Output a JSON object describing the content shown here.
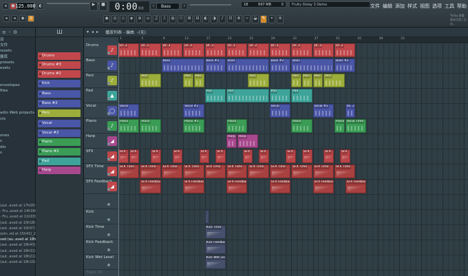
{
  "topbar": {
    "tempo": "125.000",
    "timer_main": "0:00",
    "timer_sub": "00",
    "preset_field": "Bass",
    "cpu_left": "18",
    "cpu_mid": "697 MB",
    "cpu_right": "0",
    "song_title": "Fruity Delay 3 Demo",
    "menu": [
      "文件",
      "编辑",
      "添加",
      "样式",
      "视图",
      "选项",
      "工具",
      "帮助"
    ],
    "news_line1": "Today  查看",
    "news_line2": "版本可用 | 点击..."
  },
  "browser": {
    "head_icon": "≡",
    "items": [
      {
        "label": "目",
        "hl": false
      },
      {
        "label": "文件",
        "hl": false
      },
      {
        "label": "resets",
        "hl": false
      },
      {
        "label": "展库",
        "hl": false
      },
      {
        "label": "presets",
        "hl": false
      },
      {
        "label": "esets",
        "hl": false
      },
      {
        "label": "",
        "hl": false
      },
      {
        "label": "",
        "hl": false
      },
      {
        "label": "envelopes",
        "hl": false
      },
      {
        "label": "files",
        "hl": false
      },
      {
        "label": "",
        "hl": false
      },
      {
        "label": "",
        "hl": false
      },
      {
        "label": "",
        "hl": false
      },
      {
        "label": "adio Web projects",
        "hl": false
      },
      {
        "label": "cts",
        "hl": false
      },
      {
        "label": "",
        "hl": false
      },
      {
        "label": "",
        "hl": false
      },
      {
        "label": "ones",
        "hl": false
      },
      {
        "label": "s",
        "hl": false
      },
      {
        "label": "dio",
        "hl": false
      },
      {
        "label": "s",
        "hl": false
      },
      {
        "label": "",
        "hl": false
      }
    ],
    "recent": [
      "(aut..aved at 17h05)",
      "- Fru..aved at 14h34)",
      "- Fru..aved at 11h03)",
      "(aut..aved at 10h18)",
      "(aut..aved at 10h57)",
      "ostn..ed at 15h43)_2",
      "ved (au..aved at 18h54)",
      "(aut..aved at 18h43)",
      "(aut..aved at 18h31)",
      "(aut..aved at 18h21)",
      "(aut..aved at 18h10)"
    ]
  },
  "patterns": {
    "head": "Ш",
    "items": [
      {
        "label": "Drums",
        "color": "#c0474b"
      },
      {
        "label": "Drums #3",
        "color": "#c0474b"
      },
      {
        "label": "Drums #2",
        "color": "#c0474b"
      },
      {
        "label": "Kick",
        "color": "#4a56a6"
      },
      {
        "label": "Bass",
        "color": "#4a56a6"
      },
      {
        "label": "Bass #2",
        "color": "#4a56a6"
      },
      {
        "label": "Perc",
        "color": "#9cad3b"
      },
      {
        "label": "Vocal",
        "color": "#4a56a6"
      },
      {
        "label": "Vocal #2",
        "color": "#4a56a6"
      },
      {
        "label": "Piano",
        "color": "#3a9c55"
      },
      {
        "label": "Piano #2",
        "color": "#3a9c55"
      },
      {
        "label": "Pad",
        "color": "#3ea49a"
      },
      {
        "label": "Harp",
        "color": "#a8498e"
      }
    ]
  },
  "playlist": {
    "title": "播放列表 - 编曲",
    "sub": "›(无)",
    "ruler": [
      "1",
      "5",
      "9",
      "13",
      "17",
      "21",
      "25",
      "29",
      "33",
      "37",
      "41",
      "45",
      "49",
      "53"
    ],
    "tracks": [
      {
        "name": "Drums",
        "icon": "♪",
        "color": "#c0474b"
      },
      {
        "name": "Bass",
        "icon": "♪",
        "color": "#4a56a6"
      },
      {
        "name": "Perc",
        "icon": "♪",
        "color": "#9cad3b"
      },
      {
        "name": "Pad",
        "icon": "▲",
        "color": "#3ea49a"
      },
      {
        "name": "Vocal",
        "icon": "◯",
        "color": "#4a56a6"
      },
      {
        "name": "Piano",
        "icon": "♪",
        "color": "#3a9c55"
      },
      {
        "name": "Harp",
        "icon": "◢",
        "color": "#a8498e"
      },
      {
        "name": "SFX",
        "icon": "◢",
        "color": "#c0474b"
      },
      {
        "name": "SFX Time",
        "icon": "◢",
        "color": "#c0474b"
      },
      {
        "name": "SFX Feedback",
        "icon": "◢",
        "color": "#c0474b"
      },
      {
        "name": "",
        "icon": "",
        "color": ""
      },
      {
        "name": "Kick",
        "icon": "",
        "color": ""
      },
      {
        "name": "Kick Time",
        "icon": "",
        "color": ""
      },
      {
        "name": "Kick Feedback",
        "icon": "",
        "color": ""
      },
      {
        "name": "Kick Wet Level",
        "icon": "",
        "color": ""
      },
      {
        "name": "Track 15",
        "icon": "",
        "color": ""
      }
    ],
    "clips": [
      {
        "t": 0,
        "s": 0,
        "w": 4,
        "label": "Dr..3",
        "color": "#c0474b"
      },
      {
        "t": 0,
        "s": 4,
        "w": 4,
        "label": "Dr..3",
        "color": "#c0474b"
      },
      {
        "t": 0,
        "s": 8,
        "w": 4,
        "label": "Dr..3",
        "color": "#c0474b"
      },
      {
        "t": 0,
        "s": 12,
        "w": 4,
        "label": "Dr..3",
        "color": "#c0474b"
      },
      {
        "t": 0,
        "s": 16,
        "w": 4,
        "label": "Dr..3",
        "color": "#c0474b"
      },
      {
        "t": 0,
        "s": 20,
        "w": 4,
        "label": "Dr..3",
        "color": "#c0474b"
      },
      {
        "t": 0,
        "s": 24,
        "w": 4,
        "label": "Dr..3",
        "color": "#c0474b"
      },
      {
        "t": 0,
        "s": 28,
        "w": 4,
        "label": "Dr..3",
        "color": "#c0474b"
      },
      {
        "t": 0,
        "s": 32,
        "w": 4,
        "label": "Dr..3",
        "color": "#c0474b"
      },
      {
        "t": 0,
        "s": 36,
        "w": 4,
        "label": "Dr..3",
        "color": "#c0474b"
      },
      {
        "t": 0,
        "s": 40,
        "w": 4,
        "label": "Dr..2",
        "color": "#c0474b"
      },
      {
        "t": 1,
        "s": 8,
        "w": 8,
        "label": "Bass",
        "color": "#4a56a6"
      },
      {
        "t": 1,
        "s": 16,
        "w": 4,
        "label": "Bass #2",
        "color": "#4a56a6"
      },
      {
        "t": 1,
        "s": 20,
        "w": 8,
        "label": "Bass",
        "color": "#4a56a6"
      },
      {
        "t": 1,
        "s": 28,
        "w": 4,
        "label": "Bass #2",
        "color": "#4a56a6"
      },
      {
        "t": 1,
        "s": 32,
        "w": 8,
        "label": "Bass",
        "color": "#4a56a6"
      },
      {
        "t": 1,
        "s": 40,
        "w": 4,
        "label": "Bass #2",
        "color": "#4a56a6"
      },
      {
        "t": 2,
        "s": 4,
        "w": 4,
        "label": "Perc",
        "color": "#9cad3b"
      },
      {
        "t": 2,
        "s": 12,
        "w": 2,
        "label": "Perc",
        "color": "#9cad3b"
      },
      {
        "t": 2,
        "s": 14,
        "w": 2,
        "label": "Perc",
        "color": "#9cad3b"
      },
      {
        "t": 2,
        "s": 24,
        "w": 4,
        "label": "Perc",
        "color": "#9cad3b"
      },
      {
        "t": 2,
        "s": 32,
        "w": 2,
        "label": "Perc",
        "color": "#9cad3b"
      },
      {
        "t": 2,
        "s": 34,
        "w": 2,
        "label": "Perc",
        "color": "#9cad3b"
      },
      {
        "t": 2,
        "s": 36,
        "w": 2,
        "label": "Perc",
        "color": "#9cad3b"
      },
      {
        "t": 2,
        "s": 38,
        "w": 4,
        "label": "Perc",
        "color": "#9cad3b"
      },
      {
        "t": 3,
        "s": 16,
        "w": 4,
        "label": "Pad",
        "color": "#3ea49a"
      },
      {
        "t": 3,
        "s": 20,
        "w": 8,
        "label": "Pad",
        "color": "#3ea49a"
      },
      {
        "t": 3,
        "s": 28,
        "w": 4,
        "label": "Pad",
        "color": "#3ea49a"
      },
      {
        "t": 3,
        "s": 32,
        "w": 4,
        "label": "Pad",
        "color": "#3ea49a"
      },
      {
        "t": 4,
        "s": 0,
        "w": 4,
        "label": "Vocal",
        "color": "#4a56a6"
      },
      {
        "t": 4,
        "s": 12,
        "w": 4,
        "label": "Vocal #2",
        "color": "#4a56a6"
      },
      {
        "t": 4,
        "s": 28,
        "w": 4,
        "label": "Vocal",
        "color": "#4a56a6"
      },
      {
        "t": 4,
        "s": 36,
        "w": 4,
        "label": "Vocal #2",
        "color": "#4a56a6"
      },
      {
        "t": 4,
        "s": 42,
        "w": 2,
        "label": "Vo..2",
        "color": "#4a56a6"
      },
      {
        "t": 5,
        "s": 0,
        "w": 4,
        "label": "Piano",
        "color": "#3a9c55"
      },
      {
        "t": 5,
        "s": 4,
        "w": 4,
        "label": "Piano",
        "color": "#3a9c55"
      },
      {
        "t": 5,
        "s": 12,
        "w": 4,
        "label": "Piano #2",
        "color": "#3a9c55"
      },
      {
        "t": 5,
        "s": 20,
        "w": 4,
        "label": "Piano",
        "color": "#3a9c55"
      },
      {
        "t": 5,
        "s": 32,
        "w": 4,
        "label": "Piano",
        "color": "#3a9c55"
      },
      {
        "t": 5,
        "s": 40,
        "w": 2,
        "label": "Piano #2",
        "color": "#3a9c55"
      },
      {
        "t": 5,
        "s": 42,
        "w": 4,
        "label": "Vocal Time",
        "color": "#3a9c55"
      },
      {
        "t": 6,
        "s": 20,
        "w": 2,
        "label": "Harp",
        "color": "#a8498e"
      },
      {
        "t": 6,
        "s": 22,
        "w": 4,
        "label": "Harp",
        "color": "#a8498e"
      }
    ],
    "sfx_label": "SFX",
    "sfx_time_label": "SFX Time",
    "sfx_fb_label": "SFX Feedback",
    "kick_time_label": "Kick Time",
    "kick_fb_label": "Kick Feedback",
    "kick_wet_label": "Kick Wet Level"
  },
  "colors": {
    "drums": "#c0474b",
    "bass": "#4a56a6",
    "perc": "#9cad3b",
    "pad": "#3ea49a",
    "piano": "#3a9c55",
    "harp": "#a8498e",
    "sfx": "#b84548",
    "kick": "#46506c"
  }
}
